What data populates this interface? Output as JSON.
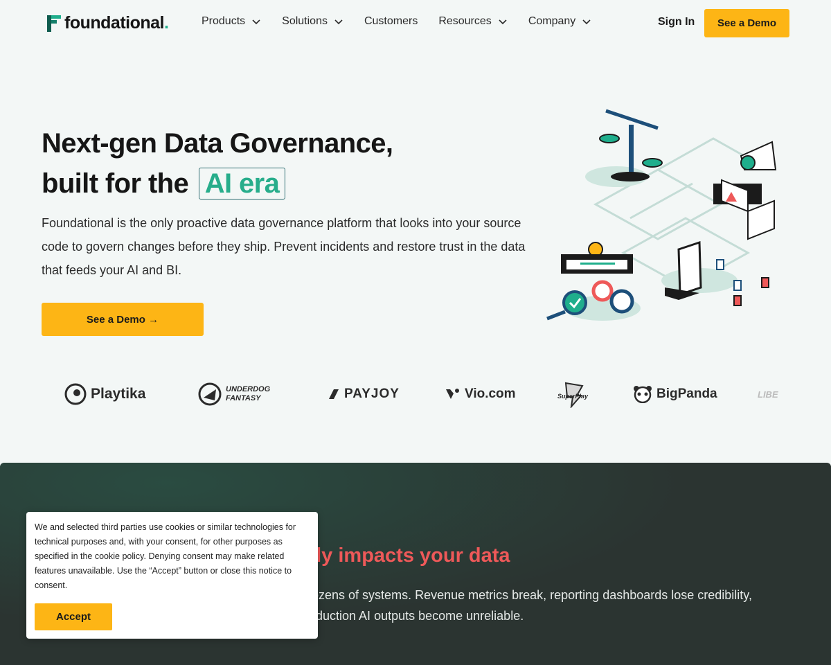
{
  "brand": {
    "name": "foundational",
    "dot": ".",
    "accent": "#fdb515",
    "green": "#1fae8c"
  },
  "nav": {
    "items": [
      {
        "label": "Products",
        "dropdown": true
      },
      {
        "label": "Solutions",
        "dropdown": true
      },
      {
        "label": "Customers",
        "dropdown": false
      },
      {
        "label": "Resources",
        "dropdown": true
      },
      {
        "label": "Company",
        "dropdown": true
      }
    ],
    "sign_in": "Sign In",
    "demo": "See a Demo"
  },
  "hero": {
    "title_line1": "Next-gen Data Governance,",
    "title_line2": "built for the",
    "title_highlight": "AI era",
    "description": "Foundational is the only proactive data governance platform that looks into your source code to govern changes before they ship. Prevent incidents and restore trust in the data that feeds your AI and BI.",
    "cta": "See a Demo →"
  },
  "customers": [
    "Playtika",
    "UNDERDOG FANTASY",
    "PAYJOY",
    "Vio.com",
    "SuperPlay",
    "BigPanda",
    "LIBE"
  ],
  "section": {
    "title_visible": "sly impacts your data",
    "desc_line1": "dozens of systems. Revenue metrics break, reporting dashboards lose credibility,",
    "desc_line2": "roduction AI outputs become unreliable."
  },
  "cookie": {
    "text": "We and selected third parties use cookies or similar technologies for technical purposes and, with your consent, for other purposes as specified in the cookie policy. Denying consent may make related features unavailable. Use the “Accept” button or close this notice to consent.",
    "accept": "Accept"
  }
}
